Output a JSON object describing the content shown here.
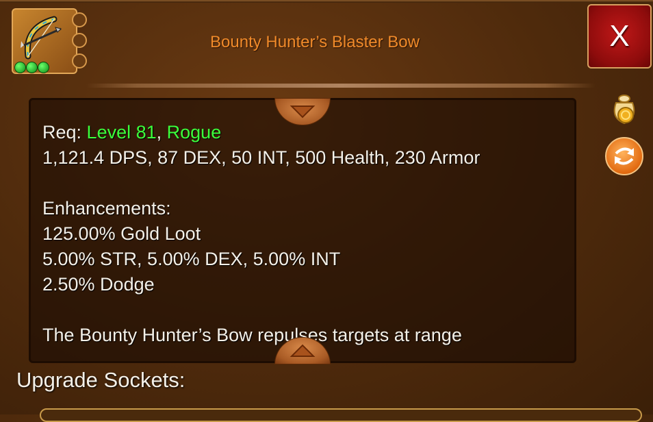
{
  "item": {
    "title": "Bounty Hunter’s Blaster Bow",
    "icon": "bow-icon",
    "gems_filled": 3,
    "empty_sockets": 3
  },
  "close_label": "X",
  "requirements": {
    "prefix": "Req: ",
    "level": "Level 81",
    "separator": ", ",
    "class": "Rogue"
  },
  "stats_line": "1,121.4 DPS, 87 DEX, 50 INT, 500 Health, 230 Armor",
  "enhancements": {
    "heading": "Enhancements:",
    "lines": [
      "125.00% Gold Loot",
      "5.00% STR, 5.00% DEX, 5.00% INT",
      "2.50% Dodge"
    ]
  },
  "description": "The Bounty Hunter’s Bow repulses targets at range",
  "upgrade_sockets_heading": "Upgrade Sockets:",
  "side_buttons": [
    "gold-bag-icon",
    "swap-arrows-icon"
  ],
  "colors": {
    "title": "#f08a2a",
    "requirement_highlight": "#3cff3c",
    "close_button": "#b01414"
  }
}
